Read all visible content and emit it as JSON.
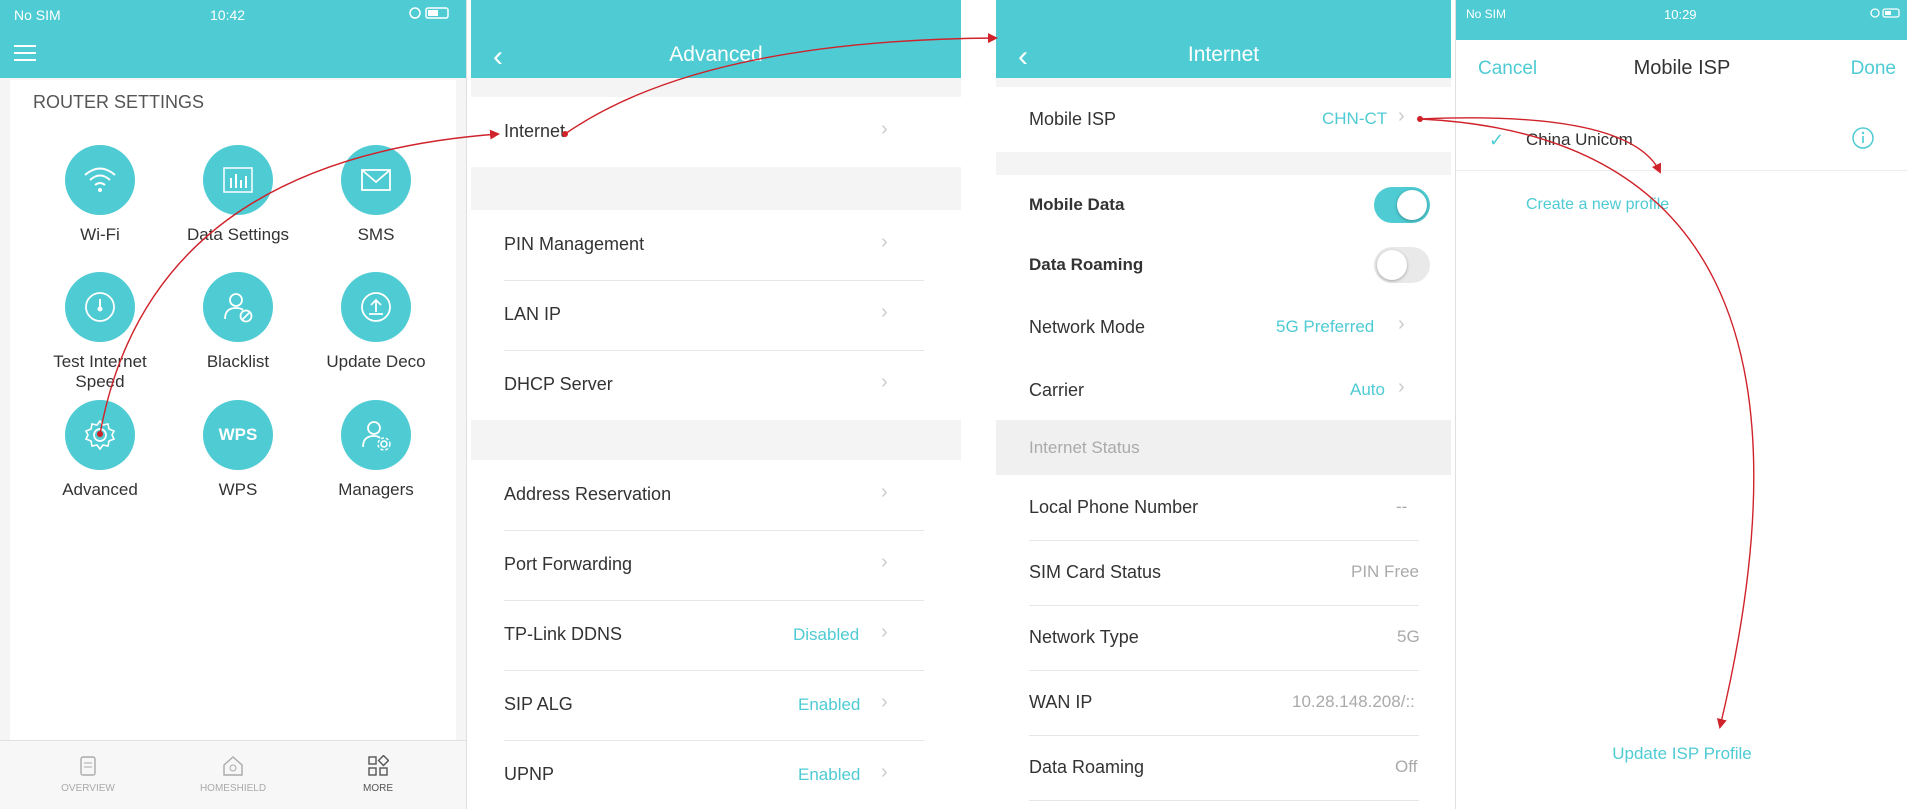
{
  "screen1": {
    "status": {
      "carrier": "No SIM",
      "time": "10:42"
    },
    "section_title": "ROUTER SETTINGS",
    "items": [
      {
        "label": "Wi-Fi",
        "icon": "wifi-icon"
      },
      {
        "label": "Data Settings",
        "icon": "chart-icon"
      },
      {
        "label": "SMS",
        "icon": "mail-icon"
      },
      {
        "label": "Test Internet Speed",
        "icon": "speedometer-icon"
      },
      {
        "label": "Blacklist",
        "icon": "user-block-icon"
      },
      {
        "label": "Update Deco",
        "icon": "upload-icon"
      },
      {
        "label": "Advanced",
        "icon": "gear-icon"
      },
      {
        "label": "WPS",
        "icon": "wps-icon"
      },
      {
        "label": "Managers",
        "icon": "user-gear-icon"
      }
    ],
    "wps_text": "WPS",
    "tabs": [
      {
        "label": "OVERVIEW"
      },
      {
        "label": "HOMESHIELD"
      },
      {
        "label": "MORE"
      }
    ]
  },
  "screen2": {
    "title": "Advanced",
    "rows": [
      {
        "label": "Internet",
        "value": ""
      },
      {
        "label": "PIN Management",
        "value": ""
      },
      {
        "label": "LAN IP",
        "value": ""
      },
      {
        "label": "DHCP Server",
        "value": ""
      },
      {
        "label": "Address Reservation",
        "value": ""
      },
      {
        "label": "Port Forwarding",
        "value": ""
      },
      {
        "label": "TP-Link DDNS",
        "value": "Disabled"
      },
      {
        "label": "SIP ALG",
        "value": "Enabled"
      },
      {
        "label": "UPNP",
        "value": "Enabled"
      }
    ]
  },
  "screen3": {
    "title": "Internet",
    "mobile_isp": {
      "label": "Mobile ISP",
      "value": "CHN-CT"
    },
    "mobile_data": {
      "label": "Mobile Data",
      "on": true
    },
    "data_roaming_toggle": {
      "label": "Data Roaming",
      "on": false
    },
    "network_mode": {
      "label": "Network Mode",
      "value": "5G Preferred"
    },
    "carrier": {
      "label": "Carrier",
      "value": "Auto"
    },
    "section": "Internet Status",
    "status_rows": [
      {
        "label": "Local Phone Number",
        "value": "--"
      },
      {
        "label": "SIM Card Status",
        "value": "PIN Free"
      },
      {
        "label": "Network Type",
        "value": "5G"
      },
      {
        "label": "WAN IP",
        "value": "10.28.148.208/::"
      },
      {
        "label": "Data Roaming",
        "value": "Off"
      }
    ]
  },
  "screen4": {
    "status": {
      "carrier": "No SIM",
      "time": "10:29"
    },
    "cancel": "Cancel",
    "title": "Mobile ISP",
    "done": "Done",
    "selected_profile": "China Unicom",
    "create_link": "Create a new profile",
    "update_link": "Update ISP Profile"
  },
  "colors": {
    "accent": "#4ecbd3",
    "arrow": "#d0222a"
  }
}
